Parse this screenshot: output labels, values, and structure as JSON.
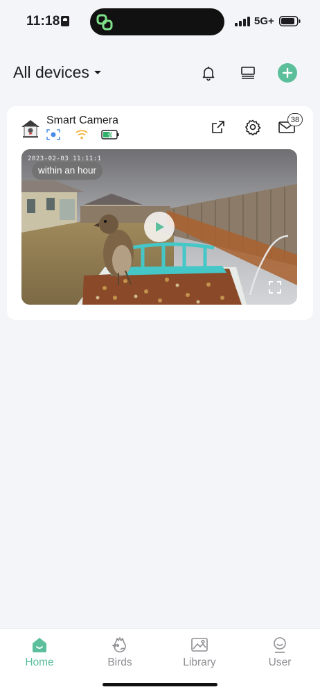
{
  "status_bar": {
    "time": "11:18",
    "network": "5G+"
  },
  "header": {
    "title": "All devices",
    "icons": [
      "bell-icon",
      "list-view-icon",
      "add-icon"
    ]
  },
  "device": {
    "name": "Smart Camera",
    "status_icons": [
      "ai-camera-icon",
      "wifi-icon",
      "battery-charging-icon"
    ],
    "message_count": "38",
    "preview": {
      "timestamp": "2023-02-03 11:11:1",
      "age_label": "within an hour"
    }
  },
  "tabs": [
    {
      "label": "Home",
      "icon": "home-icon",
      "active": true
    },
    {
      "label": "Birds",
      "icon": "bird-icon",
      "active": false
    },
    {
      "label": "Library",
      "icon": "image-icon",
      "active": false
    },
    {
      "label": "User",
      "icon": "user-icon",
      "active": false
    }
  ],
  "colors": {
    "accent": "#5bbf9c",
    "background": "#f4f5f9",
    "wifi": "#f2b43a",
    "battery": "#2fb16a"
  }
}
